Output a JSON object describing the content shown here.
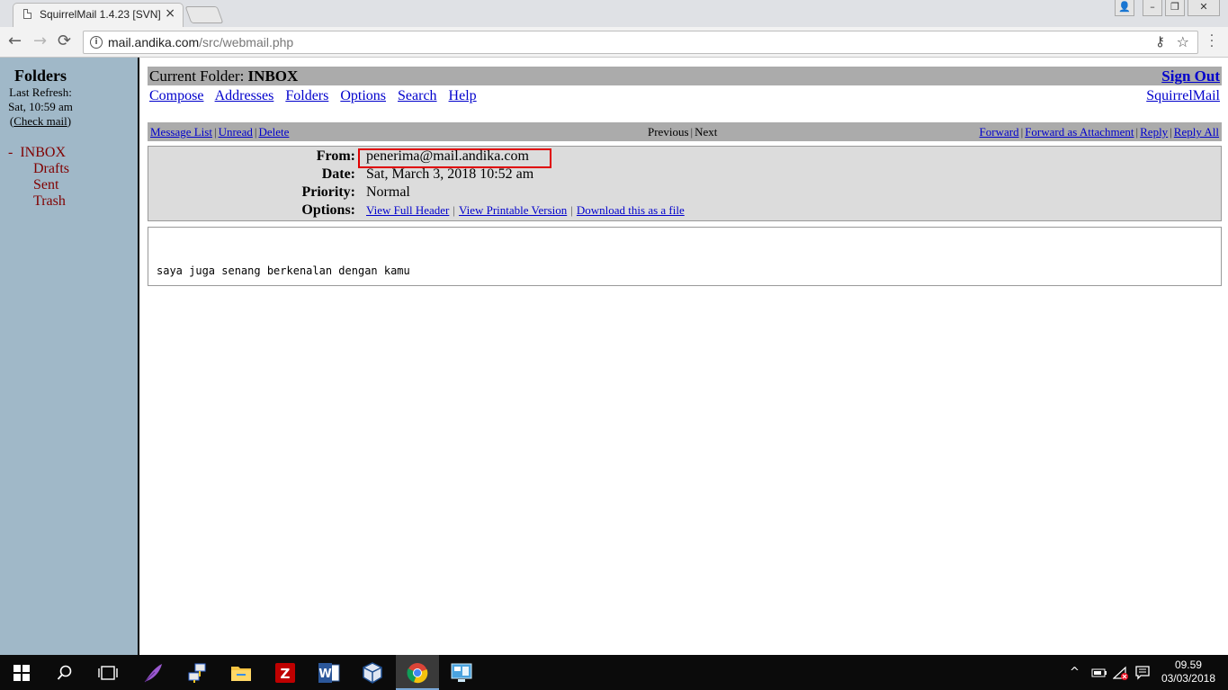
{
  "browser": {
    "tab_title": "SquirrelMail 1.4.23 [SVN]",
    "tab_close": "×",
    "url_host": "mail.andika.com",
    "url_path": "/src/webmail.php",
    "info_glyph": "i",
    "key_glyph": "⚷",
    "star_glyph": "☆",
    "back_glyph": "←",
    "forward_glyph": "→",
    "reload_glyph": "⟳",
    "menu_glyph": "⋮",
    "win_user": "👤",
    "win_min": "–",
    "win_max": "❐",
    "win_close": "✕"
  },
  "left": {
    "title": "Folders",
    "last_refresh_label": "Last Refresh:",
    "last_refresh_time": "Sat, 10:59 am",
    "check_mail_open": "(",
    "check_mail": "Check mail",
    "check_mail_close": ")",
    "expanded_marker": "-",
    "folders": [
      "INBOX",
      "Drafts",
      "Sent",
      "Trash"
    ]
  },
  "main": {
    "current_folder_label": "Current Folder:",
    "current_folder": "INBOX",
    "sign_out": "Sign Out",
    "menu": [
      "Compose",
      "Addresses",
      "Folders",
      "Options",
      "Search",
      "Help"
    ],
    "brand_link": "SquirrelMail",
    "nav_left": [
      "Message List",
      "Unread",
      "Delete"
    ],
    "nav_mid": [
      "Previous",
      "Next"
    ],
    "nav_right": [
      "Forward",
      "Forward as Attachment",
      "Reply",
      "Reply All"
    ],
    "separator": "|"
  },
  "message": {
    "from_label": "From:",
    "from": "penerima@mail.andika.com",
    "date_label": "Date:",
    "date": "Sat, March 3, 2018 10:52 am",
    "priority_label": "Priority:",
    "priority": "Normal",
    "options_label": "Options:",
    "options": [
      "View Full Header",
      "View Printable Version",
      "Download this as a file"
    ],
    "body": "saya juga senang berkenalan dengan kamu"
  },
  "taskbar": {
    "apps": [
      "windows-start",
      "search",
      "task-view",
      "feather-app",
      "network-app",
      "file-explorer",
      "filezilla",
      "word",
      "virtualbox",
      "chrome",
      "remote-desktop"
    ],
    "clock_time": "09.59",
    "clock_date": "03/03/2018",
    "tray_chevron": "^"
  },
  "colors": {
    "folder_pane": "#a0b8c8",
    "title_bar": "#ababab",
    "header_box": "#dcdcdc",
    "link": "#0000cc",
    "folder_link": "#800000",
    "highlight": "#e00000"
  }
}
